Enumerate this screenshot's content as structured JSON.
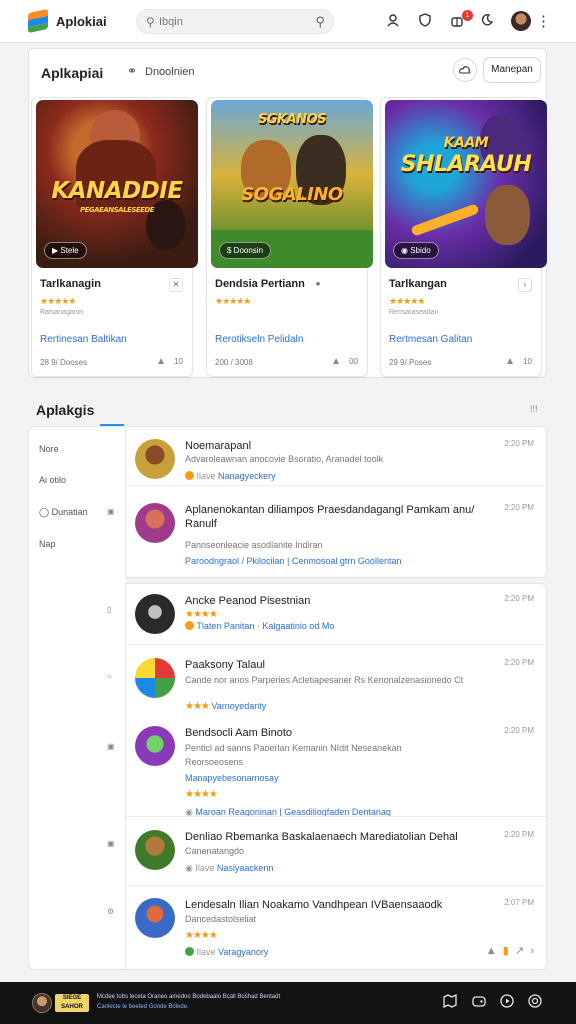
{
  "app": {
    "title": "Aplokiai"
  },
  "search": {
    "value": "",
    "placeholder": "Ibqin"
  },
  "header_icons": [
    "user-icon",
    "shield-icon",
    "gift-icon",
    "moon-icon",
    "kebab-icon"
  ],
  "notification_count": "1",
  "featured": {
    "title": "Aplkapiai",
    "subtitle": "Dnoolnien",
    "action_label": "Manepan",
    "cards": [
      {
        "art_title": "KANADDIE",
        "art_sub": "PEGAEANSALESEEDE",
        "chip": "Stele",
        "name": "Tarlkanagin",
        "meta": "Ratsanaganin",
        "link": "Rertinesan Baltikan",
        "footer": "28 9/ Dooses",
        "foot_count": "10",
        "colors": [
          "#3a1c12",
          "#8c2a1c",
          "#c66a2c"
        ]
      },
      {
        "art_title": "SOGALINO",
        "art_sub": "SGKANOS",
        "chip": "Doonsin",
        "name": "Dendsia Pertiann",
        "meta": "",
        "link": "Rerotikseln Pelidaln",
        "footer": "200 / 3008",
        "foot_count": "00",
        "colors": [
          "#2f7e2a",
          "#d9b23a",
          "#6aa8d8"
        ]
      },
      {
        "art_title": "SHLARAUH",
        "art_sub": "KAAM",
        "chip": "Sbido",
        "name": "Tarlkangan",
        "meta": "Rensaraseadan",
        "link": "Rertmesan Galitan",
        "footer": "29 9/ Poses",
        "foot_count": "10",
        "colors": [
          "#2a1a5e",
          "#6a2ea8",
          "#1ea6d8"
        ]
      }
    ]
  },
  "apps": {
    "title": "Aplakgis",
    "more": "!!!",
    "sidebar": [
      "Nore",
      "Ai otilo",
      "Dunatian",
      "Nap"
    ]
  },
  "list_a": [
    {
      "title": "Noemarapanl",
      "desc": "Advaroleawnan anocovie Bsoratio, Aranadel toolk",
      "line": "Nanagyeckery",
      "time": "2:20 PM"
    },
    {
      "title": "Aplanenokantan diliampos Praesdandagangl Pamkam anu/ Ranulf",
      "desc": "Pannseonleacie asodlanite Indiran",
      "line": "Paroodngraol / Pkilocilan | Cenmosoal gtrn Goollentan",
      "time": "2:20 PM"
    }
  ],
  "list_b": [
    {
      "title": "Ancke Peanod Pisestnian",
      "desc": "",
      "line": "Tlaten Panitan · Kalgaatinio od Mo",
      "time": "2:20 PM"
    },
    {
      "title": "Paaksony Talaul",
      "desc": "Cande nor anos Parperies Acletiapesaner Rs Kenonalzenasionedo Ct",
      "line": "Varnoyedanty",
      "time": "2:20 PM"
    },
    {
      "title": "Bendsocli Aam Binoto",
      "desc": "Penticl ad sanns Paoerlan Kemanin NIdit Neseanekan",
      "line": "Manapyebesonarnosay",
      "time": "2:20 PM"
    },
    {
      "title": "",
      "desc": "Reorsoeosens",
      "line": "Maroan Reagoninan | Geasdiliogfaden Dentanag",
      "time": ""
    },
    {
      "title": "Denliao Rbemanka Baskalaenaech Marediatolian Dehal",
      "desc": "Canenatangdo",
      "line": "Nasiyaackenn",
      "time": "2:20 PM"
    },
    {
      "title": "Lendesaln Ilian Noakamo Vandhpean IVBaensaaodk",
      "desc": "Dancedastolseliat",
      "line": "Varagyanory",
      "time": "2:07 PM"
    }
  ],
  "bottom": {
    "logo": "SIEGE\nSAHOR",
    "line1": "Mcdee tobs leceta Oraneo amedoo Bodebaalo Bcall Boshad Bentadt",
    "line2": "Canlecte le beeted Gonde Bolede."
  }
}
